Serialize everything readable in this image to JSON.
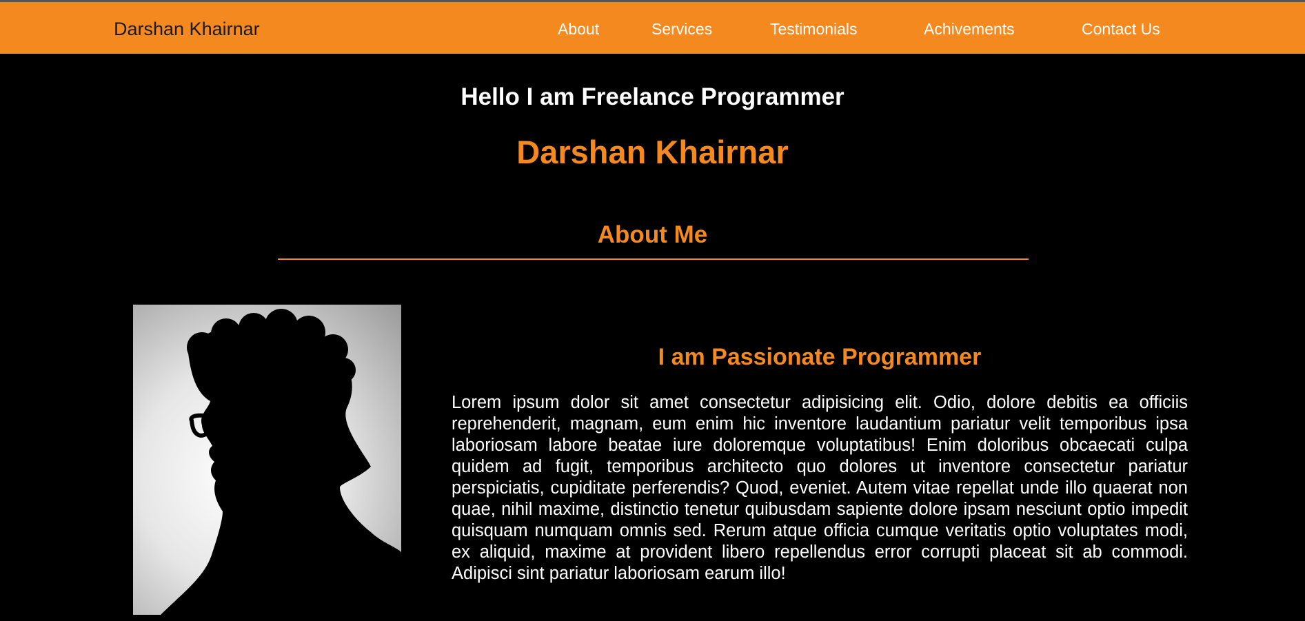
{
  "nav": {
    "brand": "Darshan Khairnar",
    "links": [
      "About",
      "Services",
      "Testimonials",
      "Achivements",
      "Contact Us"
    ]
  },
  "hero": {
    "greeting": "Hello I am Freelance Programmer",
    "name": "Darshan Khairnar"
  },
  "about": {
    "title": "About Me",
    "heading": "I am Passionate Programmer",
    "body": "Lorem ipsum dolor sit amet consectetur adipisicing elit. Odio, dolore debitis ea officiis reprehenderit, magnam, eum enim hic inventore laudantium pariatur velit temporibus ipsa laboriosam labore beatae iure doloremque voluptatibus! Enim doloribus obcaecati culpa quidem ad fugit, temporibus architecto quo dolores ut inventore consectetur pariatur perspiciatis, cupiditate perferendis? Quod, eveniet. Autem vitae repellat unde illo quaerat non quae, nihil maxime, distinctio tenetur quibusdam sapiente dolore ipsam nesciunt optio impedit quisquam numquam omnis sed. Rerum atque officia cumque veritatis optio voluptates modi, ex aliquid, maxime at provident libero repellendus error corrupti placeat sit ab commodi. Adipisci sint pariatur laboriosam earum illo!"
  },
  "colors": {
    "accent": "#f4891f",
    "background": "#000000",
    "text": "#ffffff"
  }
}
